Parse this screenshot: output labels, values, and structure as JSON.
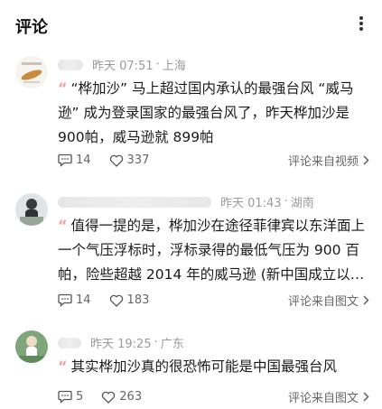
{
  "header": {
    "title": "评论"
  },
  "comments": [
    {
      "time": "昨天 07:51",
      "location": "上海",
      "quote_mark": "“",
      "text": "“桦加沙” 马上超过国内承认的最强台风 “威马逊” 成为登录国家的最强台风了，昨天桦加沙是900帕，威马逊就 899帕",
      "comments_count": "14",
      "likes_count": "337",
      "source": "评论来自视频"
    },
    {
      "time": "昨天 01:43",
      "location": "湖南",
      "quote_mark": "“",
      "text": "值得一提的是，桦加沙在途径菲律宾以东洋面上一个气压浮标时，浮标录得的最低气压为 900 百帕，险些超越 2014 年的威马逊 (新中国成立以…",
      "comments_count": "14",
      "likes_count": "183",
      "source": "评论来自图文"
    },
    {
      "time": "昨天 19:25",
      "location": "广东",
      "quote_mark": "“",
      "text": "其实桦加沙真的很恐怖可能是中国最强台风",
      "comments_count": "5",
      "likes_count": "263",
      "source": "评论来自图文"
    }
  ],
  "separator": "·",
  "icons": {
    "more": "more-vertical-icon",
    "comment": "comment-bubble-icon",
    "like": "heart-icon",
    "chevron": "chevron-right-icon"
  },
  "colors": {
    "quote": "#f0a3a3",
    "meta": "#9a9a9a"
  }
}
